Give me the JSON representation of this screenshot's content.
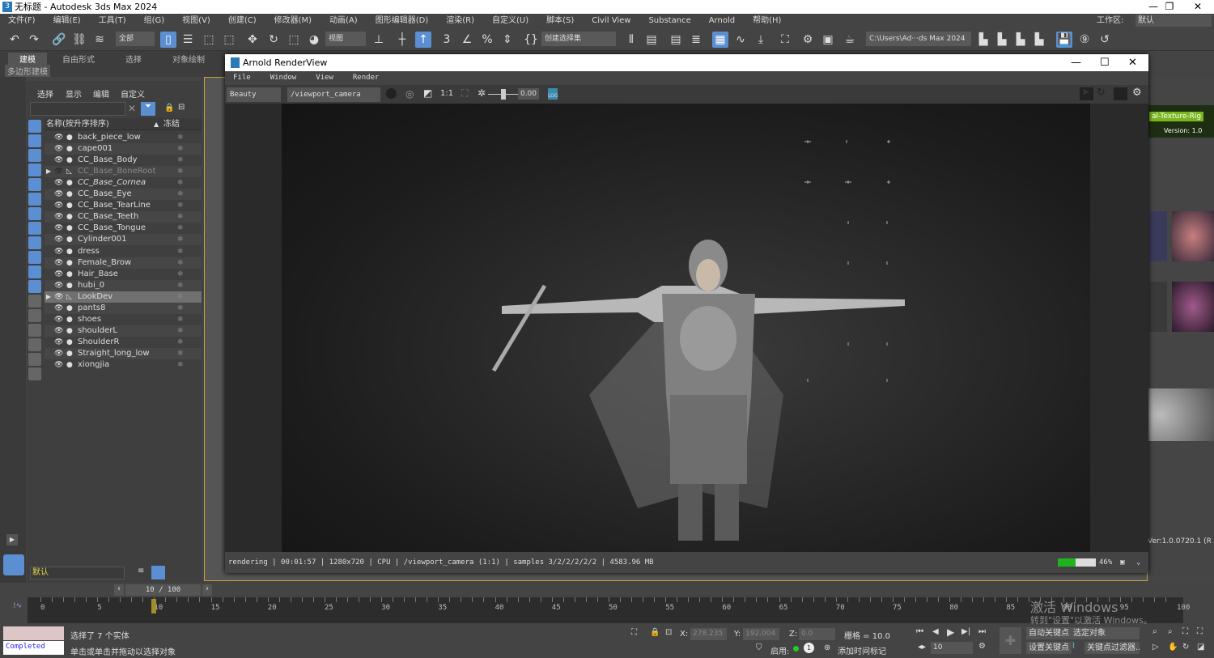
{
  "window": {
    "title": "无标题 - Autodesk 3ds Max 2024",
    "icon": "3dsmax-logo-icon"
  },
  "menu": [
    "文件(F)",
    "编辑(E)",
    "工具(T)",
    "组(G)",
    "视图(V)",
    "创建(C)",
    "修改器(M)",
    "动画(A)",
    "图形编辑器(D)",
    "渲染(R)",
    "自定义(U)",
    "脚本(S)",
    "Civil View",
    "Substance",
    "Arnold",
    "帮助(H)"
  ],
  "workspace": {
    "label": "工作区:",
    "value": "默认"
  },
  "toolbar": {
    "selection_filter": "全部",
    "ref_coord": "视图",
    "named_selection": "创建选择集",
    "project_path": "C:\\Users\\Ad···ds Max 2024"
  },
  "ribbon": {
    "tabs": [
      "建模",
      "自由形式",
      "选择",
      "对象绘制"
    ],
    "active": "建模",
    "sub": "多边形建模"
  },
  "explorer": {
    "menu": [
      "选择",
      "显示",
      "编辑",
      "自定义"
    ],
    "search_placeholder": "",
    "columns": {
      "name": "名称(按升序排序)",
      "frozen": "冻结"
    },
    "rows": [
      {
        "name": "back_piece_low"
      },
      {
        "name": "cape001"
      },
      {
        "name": "CC_Base_Body"
      },
      {
        "name": "CC_Base_BoneRoot",
        "hidden": true,
        "bone": true,
        "expandable": true
      },
      {
        "name": "CC_Base_Cornea",
        "italic": true
      },
      {
        "name": "CC_Base_Eye"
      },
      {
        "name": "CC_Base_TearLine"
      },
      {
        "name": "CC_Base_Teeth"
      },
      {
        "name": "CC_Base_Tongue"
      },
      {
        "name": "Cylinder001"
      },
      {
        "name": "dress"
      },
      {
        "name": "Female_Brow"
      },
      {
        "name": "Hair_Base"
      },
      {
        "name": "hubi_0"
      },
      {
        "name": "LookDev",
        "bone": true,
        "expandable": true,
        "selected": true
      },
      {
        "name": "pants8"
      },
      {
        "name": "shoes"
      },
      {
        "name": "shoulderL"
      },
      {
        "name": "ShoulderR"
      },
      {
        "name": "Straight_long_low"
      },
      {
        "name": "xiongjia"
      }
    ],
    "layer": "默认"
  },
  "renderview": {
    "title": "Arnold RenderView",
    "menu": [
      "File",
      "Window",
      "View",
      "Render"
    ],
    "aov": "Beauty",
    "camera": "/viewport_camera",
    "ratio": "1:1",
    "exposure": "0.00",
    "status": "rendering | 00:01:57 | 1280x720 | CPU | /viewport_camera (1:1) | samples 3/2/2/2/2/2 | 4583.96 MB",
    "progress": 46,
    "progress_label": "46%",
    "progress_color": "#1fb31f"
  },
  "rightpanel": {
    "banner": "al-Texture-Rig",
    "version": "Version: 1.0",
    "ver_label": "Ver:1.0.0720.1 (R",
    "banner_color": "#7ab51d"
  },
  "timeline": {
    "frame_label": "10 / 100",
    "current": 10,
    "ticks": [
      "0",
      "5",
      "10",
      "15",
      "20",
      "25",
      "30",
      "35",
      "40",
      "45",
      "50",
      "55",
      "60",
      "65",
      "70",
      "75",
      "80",
      "85",
      "90",
      "95",
      "100"
    ]
  },
  "status": {
    "script_state": "Completed",
    "selection": "选择了 7 个实体",
    "prompt": "单击或单击并拖动以选择对象",
    "x_label": "X:",
    "x": "278.235",
    "y_label": "Y:",
    "y": "192.004",
    "z_label": "Z:",
    "z": "0.0",
    "grid": "栅格 = 10.0",
    "enable": "启用:",
    "add_time_tag": "添加时间标记",
    "frame": "10",
    "auto_key": "自动关键点",
    "set_key": "设置关键点",
    "key_target": "选定对象",
    "key_filters": "关键点过滤器..."
  },
  "watermark": {
    "line1": "激活 Windows",
    "line2": "转到\"设置\"以激活 Windows。"
  }
}
